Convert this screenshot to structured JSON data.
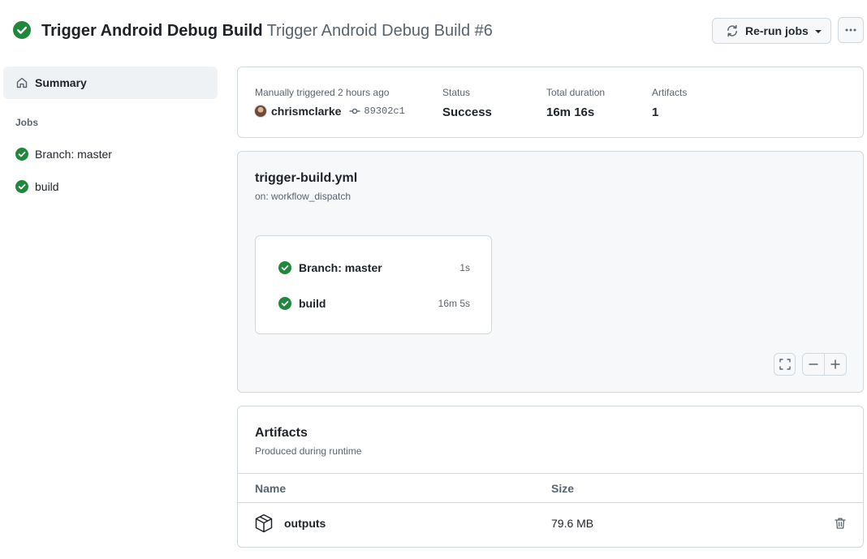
{
  "header": {
    "workflow_name": "Trigger Android Debug Build",
    "run_title": "Trigger Android Debug Build #6",
    "rerun_label": "Re-run jobs",
    "status_icon": "check-circle-fill-icon"
  },
  "sidebar": {
    "summary_label": "Summary",
    "jobs_heading": "Jobs",
    "jobs": [
      {
        "label": "Branch: master",
        "status": "success"
      },
      {
        "label": "build",
        "status": "success"
      }
    ]
  },
  "summary": {
    "trigger_label": "Manually triggered 2 hours ago",
    "actor": "chrismclarke",
    "commit": "89302c1",
    "status_label": "Status",
    "status_value": "Success",
    "duration_label": "Total duration",
    "duration_value": "16m 16s",
    "artifacts_label": "Artifacts",
    "artifacts_value": "1"
  },
  "graph": {
    "file": "trigger-build.yml",
    "trigger": "on: workflow_dispatch",
    "jobs": [
      {
        "name": "Branch: master",
        "duration": "1s"
      },
      {
        "name": "build",
        "duration": "16m 5s"
      }
    ]
  },
  "artifacts": {
    "title": "Artifacts",
    "subtitle": "Produced during runtime",
    "columns": {
      "name": "Name",
      "size": "Size"
    },
    "rows": [
      {
        "name": "outputs",
        "size": "79.6 MB"
      }
    ]
  },
  "colors": {
    "success": "#1f883d",
    "border": "#d1d9e0",
    "muted": "#59636e",
    "canvas": "#f6f8fa"
  }
}
